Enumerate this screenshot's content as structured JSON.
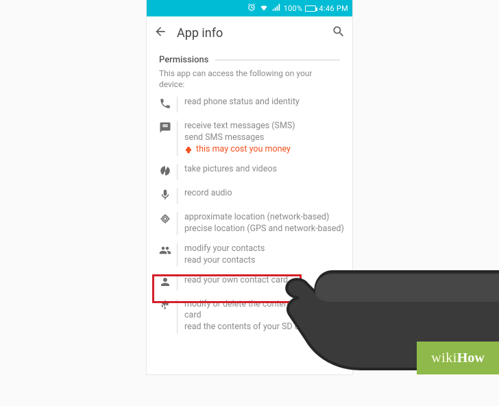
{
  "statusbar": {
    "battery_pct": "100%",
    "clock": "4:46 PM"
  },
  "toolbar": {
    "title": "App info"
  },
  "section": {
    "title": "Permissions",
    "description": "This app can access the following on your device:"
  },
  "permissions": {
    "phone": {
      "lines": [
        "read phone status and identity"
      ]
    },
    "sms": {
      "lines": [
        "receive text messages (SMS)",
        "send SMS messages"
      ],
      "warning": "this may cost you money"
    },
    "camera": {
      "lines": [
        "take pictures and videos"
      ]
    },
    "mic": {
      "lines": [
        "record audio"
      ]
    },
    "location": {
      "lines": [
        "approximate location (network-based)",
        "precise location (GPS and network-based)"
      ]
    },
    "contacts": {
      "lines": [
        "modify your contacts",
        "read your contacts"
      ]
    },
    "owncontact": {
      "lines": [
        "read your own contact card"
      ]
    },
    "storage": {
      "lines": [
        "modify or delete the contents of your SD card",
        "read the contents of your SD card"
      ]
    }
  },
  "watermark": {
    "wiki": "wiki",
    "how": "How"
  }
}
